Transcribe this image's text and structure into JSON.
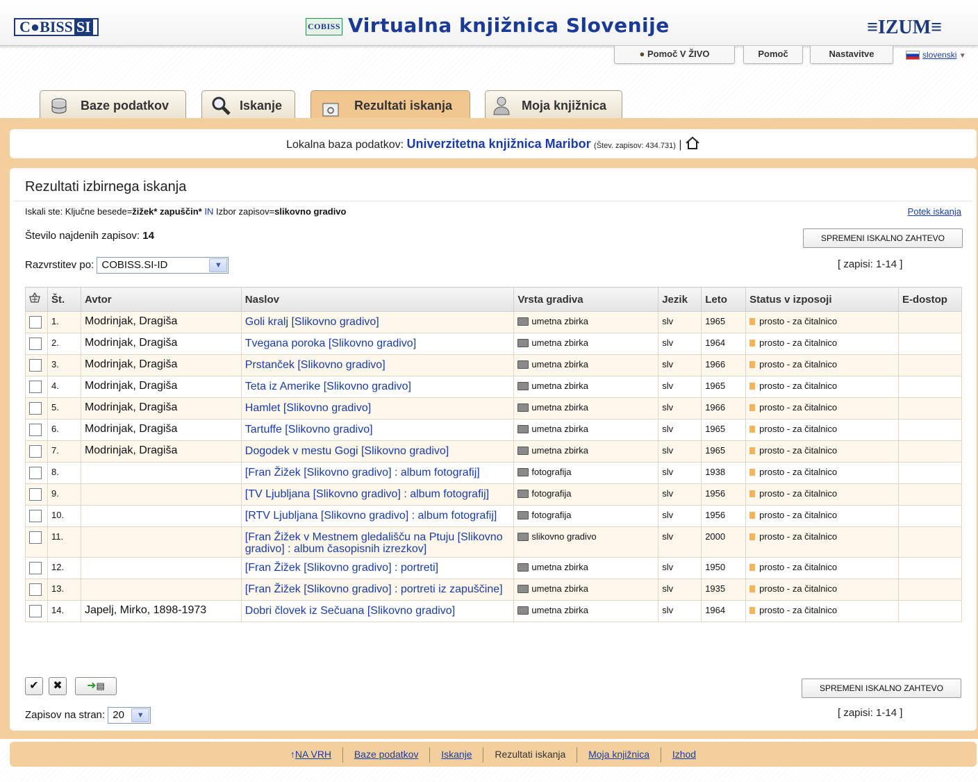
{
  "header": {
    "logo_cobiss": "C●BISS",
    "logo_si": "SI",
    "mini_logo": "COBISS",
    "title": "Virtualna knjižnica Slovenije",
    "logo_izum": "≡IZUM≡"
  },
  "topnav": {
    "help_live": "Pomoč V ŽIVO",
    "help": "Pomoč",
    "settings": "Nastavitve",
    "language": "slovenski"
  },
  "tabs": [
    {
      "label": "Baze podatkov"
    },
    {
      "label": "Iskanje"
    },
    {
      "label": "Rezultati iskanja"
    },
    {
      "label": "Moja knjižnica"
    }
  ],
  "dbbar": {
    "prefix": "Lokalna baza podatkov:",
    "library": "Univerzitetna knjižnica Maribor",
    "count": "(Štev. zapisov: 434.731)",
    "sep": "|"
  },
  "results": {
    "heading": "Rezultati izbirnega iskanja",
    "query_prefix": "Iskali ste: Ključne besede=",
    "query_terms": "žižek* zapuščin*",
    "query_in": "IN",
    "query_filter_label": "Izbor zapisov=",
    "query_filter": "slikovno gradivo",
    "history_link": "Potek iskanja",
    "count_label": "Število najdenih zapisov:",
    "count_value": "14",
    "change_button": "SPREMENI ISKALNO ZAHTEVO",
    "range": "[ zapisi: 1-14 ]",
    "sort_label": "Razvrstitev po:",
    "sort_value": "COBISS.SI-ID",
    "perpage_label": "Zapisov na stran:",
    "perpage_value": "20"
  },
  "table": {
    "headers": [
      "Št.",
      "Avtor",
      "Naslov",
      "Vrsta gradiva",
      "Jezik",
      "Leto",
      "Status v izposoji",
      "E-dostop"
    ],
    "rows": [
      {
        "num": "1.",
        "author": "Modrinjak, Dragiša",
        "title": "Goli kralj [Slikovno gradivo]",
        "type": "umetna zbirka",
        "lang": "slv",
        "year": "1965",
        "status": "prosto - za čitalnico"
      },
      {
        "num": "2.",
        "author": "Modrinjak, Dragiša",
        "title": "Tvegana poroka [Slikovno gradivo]",
        "type": "umetna zbirka",
        "lang": "slv",
        "year": "1964",
        "status": "prosto - za čitalnico"
      },
      {
        "num": "3.",
        "author": "Modrinjak, Dragiša",
        "title": "Prstanček [Slikovno gradivo]",
        "type": "umetna zbirka",
        "lang": "slv",
        "year": "1966",
        "status": "prosto - za čitalnico"
      },
      {
        "num": "4.",
        "author": "Modrinjak, Dragiša",
        "title": "Teta iz Amerike [Slikovno gradivo]",
        "type": "umetna zbirka",
        "lang": "slv",
        "year": "1965",
        "status": "prosto - za čitalnico"
      },
      {
        "num": "5.",
        "author": "Modrinjak, Dragiša",
        "title": "Hamlet [Slikovno gradivo]",
        "type": "umetna zbirka",
        "lang": "slv",
        "year": "1966",
        "status": "prosto - za čitalnico"
      },
      {
        "num": "6.",
        "author": "Modrinjak, Dragiša",
        "title": "Tartuffe [Slikovno gradivo]",
        "type": "umetna zbirka",
        "lang": "slv",
        "year": "1965",
        "status": "prosto - za čitalnico"
      },
      {
        "num": "7.",
        "author": "Modrinjak, Dragiša",
        "title": "Dogodek v mestu Gogi [Slikovno gradivo]",
        "type": "umetna zbirka",
        "lang": "slv",
        "year": "1965",
        "status": "prosto - za čitalnico"
      },
      {
        "num": "8.",
        "author": "",
        "title": "[Fran Žižek [Slikovno gradivo] : album fotografij]",
        "type": "fotografija",
        "lang": "slv",
        "year": "1938",
        "status": "prosto - za čitalnico"
      },
      {
        "num": "9.",
        "author": "",
        "title": "[TV Ljubljana [Slikovno gradivo] : album fotografij]",
        "type": "fotografija",
        "lang": "slv",
        "year": "1956",
        "status": "prosto - za čitalnico"
      },
      {
        "num": "10.",
        "author": "",
        "title": "[RTV Ljubljana [Slikovno gradivo] : album fotografij]",
        "type": "fotografija",
        "lang": "slv",
        "year": "1956",
        "status": "prosto - za čitalnico"
      },
      {
        "num": "11.",
        "author": "",
        "title": "[Fran Žižek v Mestnem gledališču na Ptuju [Slikovno gradivo] : album časopisnih izrezkov]",
        "type": "slikovno gradivo",
        "lang": "slv",
        "year": "2000",
        "status": "prosto - za čitalnico"
      },
      {
        "num": "12.",
        "author": "",
        "title": "[Fran Žižek [Slikovno gradivo] : portreti]",
        "type": "umetna zbirka",
        "lang": "slv",
        "year": "1950",
        "status": "prosto - za čitalnico"
      },
      {
        "num": "13.",
        "author": "",
        "title": "[Fran Žižek [Slikovno gradivo] : portreti iz zapuščine]",
        "type": "umetna zbirka",
        "lang": "slv",
        "year": "1935",
        "status": "prosto - za čitalnico"
      },
      {
        "num": "14.",
        "author": "Japelj, Mirko, 1898-1973",
        "title": "Dobri človek iz Sečuana [Slikovno gradivo]",
        "type": "umetna zbirka",
        "lang": "slv",
        "year": "1964",
        "status": "prosto - za čitalnico"
      }
    ]
  },
  "footer": {
    "top": "NA VRH",
    "databases": "Baze podatkov",
    "search": "Iskanje",
    "results": "Rezultati iskanja",
    "mylib": "Moja knjižnica",
    "logout": "Izhod"
  },
  "icons": {
    "status_color": "#f5b35a",
    "accent": "#f3cf9e",
    "link": "#1a3ca8"
  }
}
